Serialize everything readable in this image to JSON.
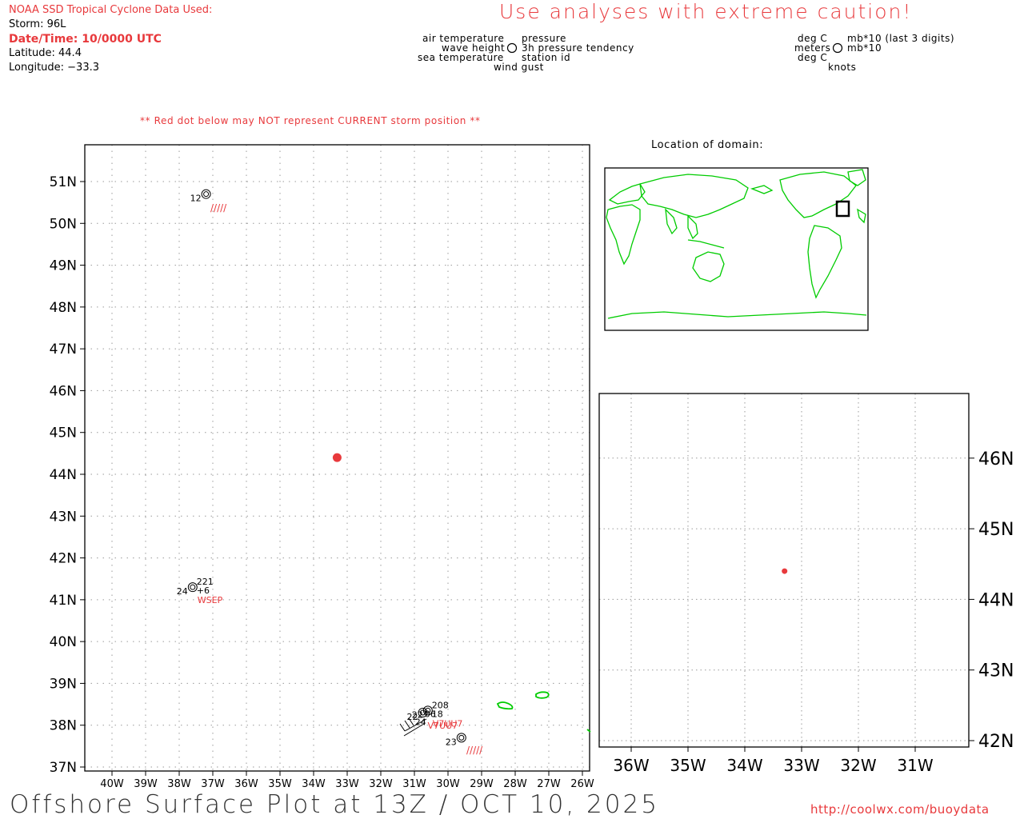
{
  "header": {
    "source": "NOAA SSD Tropical Cyclone Data Used:",
    "storm": "Storm: 96L",
    "datetime": "Date/Time: 10/0000 UTC",
    "latitude": "Latitude: 44.4",
    "longitude": "Longitude: −33.3"
  },
  "caution": "Use analyses with extreme caution!",
  "legend_left": {
    "air_temperature": "air temperature",
    "pressure": "pressure",
    "wave_height": "wave height",
    "tendency": "3h pressure tendency",
    "sea_temperature": "sea temperature",
    "station_id": "station id",
    "wind_gust": "wind gust"
  },
  "legend_right": {
    "air_unit": "deg C",
    "pressure_unit": "mb*10 (last 3 digits)",
    "wave_unit": "meters",
    "tendency_unit": "mb*10",
    "sea_unit": "deg C",
    "gust_unit": "knots"
  },
  "red_dot_note": "** Red dot below may NOT represent CURRENT storm position **",
  "domain_label": "Location of domain:",
  "main_map": {
    "lat_labels": [
      "51N",
      "50N",
      "49N",
      "48N",
      "47N",
      "46N",
      "45N",
      "44N",
      "43N",
      "42N",
      "41N",
      "40N",
      "39N",
      "38N",
      "37N"
    ],
    "lon_labels": [
      "40W",
      "39W",
      "38W",
      "37W",
      "36W",
      "35W",
      "34W",
      "33W",
      "32W",
      "31W",
      "30W",
      "29W",
      "28W",
      "27W",
      "26W"
    ],
    "storm_position": {
      "lat": 44.4,
      "lon": -33.3
    },
    "stations": [
      {
        "lat": 50.7,
        "lon": -37.2,
        "left": "12",
        "right_top": "",
        "right_mid": "",
        "id": ""
      },
      {
        "lat": 41.3,
        "lon": -37.6,
        "left": "24",
        "right_top": "221",
        "right_mid": "+6",
        "id": "WSEP"
      },
      {
        "lat": 38.35,
        "lon": -30.6,
        "left": "22",
        "right_top": "208",
        "right_mid": "18",
        "id": "V7UU7"
      },
      {
        "lat": 38.3,
        "lon": -30.75,
        "left": "22",
        "right_top": "",
        "right_mid": "",
        "id": "V7UU7"
      },
      {
        "lat": 37.7,
        "lon": -29.6,
        "left": "23",
        "right_top": "",
        "right_mid": "",
        "id": ""
      }
    ],
    "extra_labels": {
      "station3_wave": "24",
      "station3_code": "06"
    }
  },
  "inset_map": {
    "lat_labels": [
      "46N",
      "45N",
      "44N",
      "43N",
      "42N"
    ],
    "lon_labels": [
      "36W",
      "35W",
      "34W",
      "33W",
      "32W",
      "31W"
    ],
    "storm_position": {
      "lat": 44.4,
      "lon": -33.3
    }
  },
  "footer": {
    "title": "Offshore Surface Plot at 13Z / OCT 10, 2025",
    "url": "http://coolwx.com/buoydata"
  },
  "colors": {
    "accent": "#e8393c",
    "land": "#00cc00",
    "grid": "#9a9a9a"
  }
}
